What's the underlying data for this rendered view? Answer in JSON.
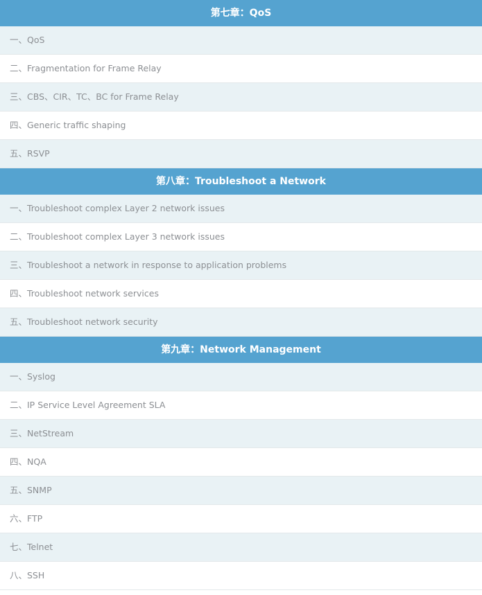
{
  "chapters": [
    {
      "title": "第七章：QoS",
      "items": [
        "一、QoS",
        "二、Fragmentation for Frame Relay",
        "三、CBS、CIR、TC、BC for Frame Relay",
        "四、Generic traffic shaping",
        "五、RSVP"
      ]
    },
    {
      "title": "第八章：Troubleshoot a Network",
      "items": [
        "一、Troubleshoot complex Layer 2 network issues",
        "二、Troubleshoot complex Layer 3 network issues",
        "三、Troubleshoot a network in response to application problems",
        "四、Troubleshoot network services",
        "五、Troubleshoot network security"
      ]
    },
    {
      "title": "第九章：Network Management",
      "items": [
        "一、Syslog",
        "二、IP Service Level Agreement SLA",
        "三、NetStream",
        "四、NQA",
        "五、SNMP",
        "六、FTP",
        "七、Telnet",
        "八、SSH"
      ]
    }
  ],
  "colors": {
    "header_bg": "#55a3d0",
    "header_text": "#ffffff",
    "row_alt_bg": "#e9f2f5",
    "row_bg": "#ffffff",
    "row_text": "#8c8f93"
  }
}
